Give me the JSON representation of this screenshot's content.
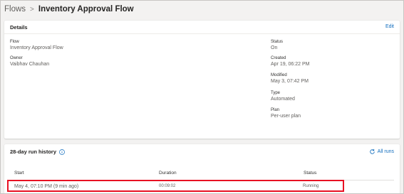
{
  "breadcrumb": {
    "parent": "Flows",
    "separator": ">",
    "current": "Inventory Approval Flow"
  },
  "details": {
    "title": "Details",
    "edit_label": "Edit",
    "left": [
      {
        "label": "Flow",
        "value": "Inventory Approval Flow"
      },
      {
        "label": "Owner",
        "value": "Vaibhav Chauhan"
      }
    ],
    "right": [
      {
        "label": "Status",
        "value": "On"
      },
      {
        "label": "Created",
        "value": "Apr 19, 06:22 PM"
      },
      {
        "label": "Modified",
        "value": "May 3, 07:42 PM"
      },
      {
        "label": "Type",
        "value": "Automated"
      },
      {
        "label": "Plan",
        "value": "Per-user plan"
      }
    ]
  },
  "run_history": {
    "title": "28-day run history",
    "all_runs_label": "All runs",
    "columns": [
      "Start",
      "Duration",
      "Status"
    ],
    "rows": [
      {
        "start": "May 4, 07:10 PM (9 min ago)",
        "duration": "00:09:02",
        "status": "Running"
      }
    ]
  },
  "colors": {
    "accent": "#0f6cbd",
    "highlight": "#e81123"
  },
  "icons": {
    "info": "info-icon",
    "refresh": "refresh-icon"
  }
}
